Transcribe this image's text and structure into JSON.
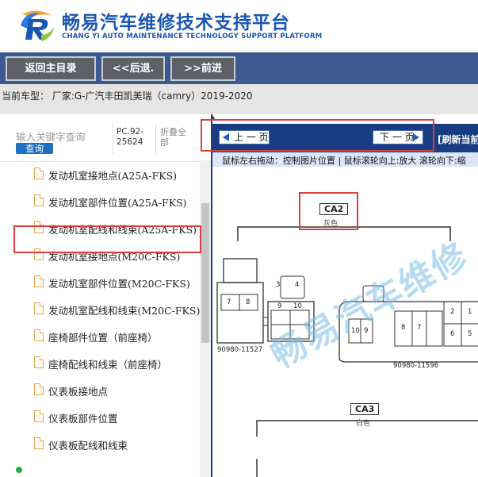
{
  "header": {
    "title_cn": "畅易汽车维修技术支持平台",
    "title_en": "CHANG YI AUTO MAINTENANCE TECHNOLOGY SUPPORT PLATFORM",
    "brand_color": "#1a56b4"
  },
  "toolbar": {
    "home_label": "返回主目录",
    "back_label": "<<后退.",
    "forward_label": ">>前进"
  },
  "current_model": "当前车型： 厂家:G-广汽丰田凯美瑞（camry）2019-2020",
  "search": {
    "placeholder": "输入关键字查询",
    "button_label": "查询",
    "pc_code": "PC.92-25624",
    "collapse_label": "折叠全部"
  },
  "tree": {
    "items": [
      {
        "label": "发动机室接地点(A25A-FKS)"
      },
      {
        "label": "发动机室部件位置(A25A-FKS)"
      },
      {
        "label": "发动机室配线和线束(A25A-FKS)",
        "highlighted": true
      },
      {
        "label": "发动机室接地点(M20C-FKS)"
      },
      {
        "label": "发动机室部件位置(M20C-FKS)"
      },
      {
        "label": "发动机室配线和线束(M20C-FKS)"
      },
      {
        "label": "座椅部件位置（前座椅）"
      },
      {
        "label": "座椅配线和线束（前座椅）"
      },
      {
        "label": "仪表板接地点"
      },
      {
        "label": "仪表板部件位置"
      },
      {
        "label": "仪表板配线和线束"
      }
    ]
  },
  "viewer": {
    "prev_label": "上 一 页",
    "next_label": "下 一 页",
    "refresh_label": "[刷新当前",
    "hint": "鼠标左右拖动：控制图片位置 | 鼠标滚轮向上:放大  滚轮向下:缩",
    "connectors": [
      {
        "code": "CA2",
        "color": "灰色"
      },
      {
        "code": "CA3",
        "color": "白色"
      }
    ],
    "part_numbers": [
      "90980-11527",
      "90980-11596"
    ],
    "pin_numbers_left": [
      "3",
      "4",
      "7",
      "8",
      "9",
      "10"
    ],
    "pin_numbers_right": [
      "2",
      "1",
      "10",
      "9",
      "8",
      "7",
      "6",
      "5"
    ],
    "watermark": "畅易汽车维修"
  },
  "colors": {
    "toolbar_bg": "#3d5a90",
    "pager_bg": "#183d82",
    "highlight": "#d94040",
    "watermark": "#7abee6"
  }
}
